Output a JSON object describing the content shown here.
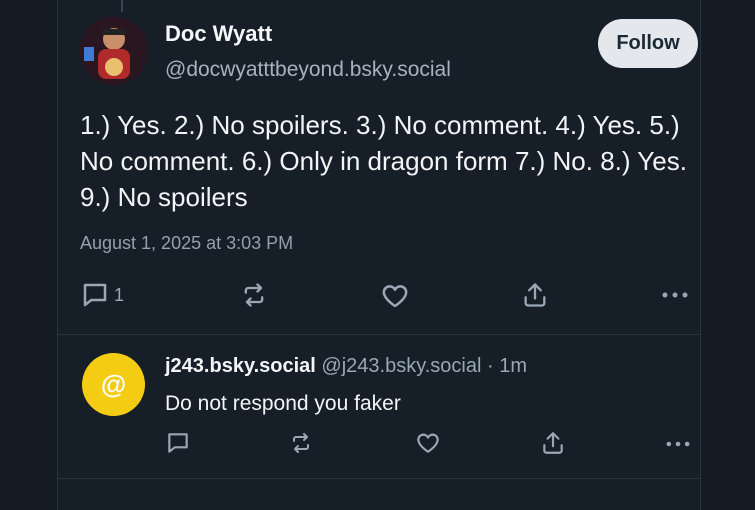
{
  "post": {
    "author_name": "Doc Wyatt",
    "author_handle": "@docwyatttbeyond.bsky.social",
    "follow_label": "Follow",
    "text": "1.) Yes. 2.) No spoilers. 3.) No comment. 4.) Yes. 5.) No comment. 6.) Only in dragon form 7.) No. 8.) Yes. 9.) No spoilers",
    "timestamp": "August 1, 2025 at 3:03 PM",
    "reply_count": "1",
    "icons": [
      "reply-icon",
      "repost-icon",
      "like-icon",
      "share-icon",
      "more-icon"
    ]
  },
  "reply": {
    "avatar_glyph": "@",
    "author_name": "j243.bsky.social",
    "author_handle": "@j243.bsky.social",
    "separator": "·",
    "time": "1m",
    "text": "Do not respond you faker",
    "icons": [
      "reply-icon",
      "repost-icon",
      "like-icon",
      "share-icon",
      "more-icon"
    ]
  },
  "colors": {
    "background": "#141b24",
    "text": "#f1f3f5",
    "muted": "#9aa7b5",
    "follow_bg": "#e4e8ec",
    "reply_avatar": "#f5cc14"
  }
}
